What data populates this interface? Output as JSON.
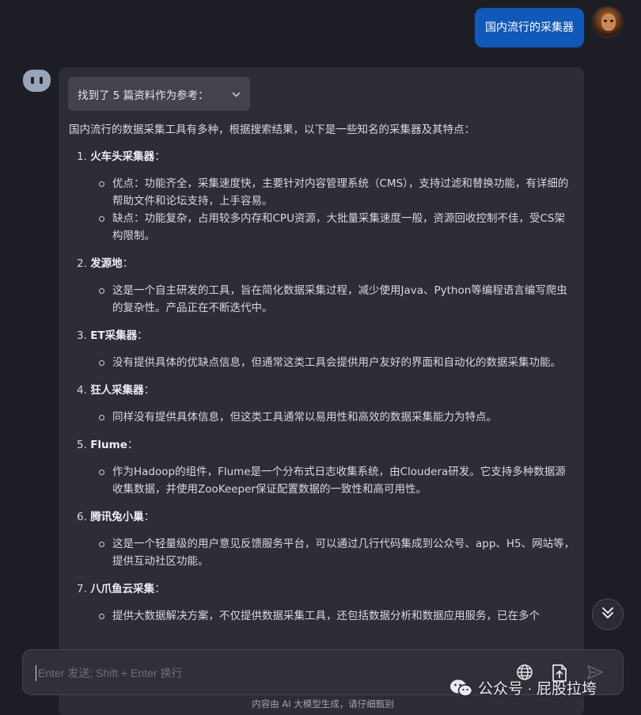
{
  "user_message": "国内流行的采集器",
  "sources_toggle": "找到了 5 篇资料作为参考：",
  "intro": "国内流行的数据采集工具有多种，根据搜索结果，以下是一些知名的采集器及其特点：",
  "items": [
    {
      "num": "1.",
      "name": "火车头采集器",
      "suffix": "：",
      "subs": [
        "优点：功能齐全，采集速度快，主要针对内容管理系统（CMS），支持过滤和替换功能，有详细的帮助文件和论坛支持，上手容易。",
        "缺点：功能复杂，占用较多内存和CPU资源，大批量采集速度一般，资源回收控制不佳，受CS架构限制。"
      ]
    },
    {
      "num": "2.",
      "name": "发源地",
      "suffix": "：",
      "subs": [
        "这是一个自主研发的工具，旨在简化数据采集过程，减少使用Java、Python等编程语言编写爬虫的复杂性。产品正在不断迭代中。"
      ]
    },
    {
      "num": "3.",
      "name": "ET采集器",
      "suffix": "：",
      "subs": [
        "没有提供具体的优缺点信息，但通常这类工具会提供用户友好的界面和自动化的数据采集功能。"
      ]
    },
    {
      "num": "4.",
      "name": "狂人采集器",
      "suffix": "：",
      "subs": [
        "同样没有提供具体信息，但这类工具通常以易用性和高效的数据采集能力为特点。"
      ]
    },
    {
      "num": "5.",
      "name": "Flume",
      "suffix": "：",
      "subs": [
        "作为Hadoop的组件，Flume是一个分布式日志收集系统，由Cloudera研发。它支持多种数据源收集数据，并使用ZooKeeper保证配置数据的一致性和高可用性。"
      ]
    },
    {
      "num": "6.",
      "name": "腾讯兔小巢",
      "suffix": "：",
      "subs": [
        "这是一个轻量级的用户意见反馈服务平台，可以通过几行代码集成到公众号、app、H5、网站等，提供互动社区功能。"
      ]
    },
    {
      "num": "7.",
      "name": "八爪鱼云采集",
      "suffix": "：",
      "subs": [
        "提供大数据解决方案，不仅提供数据采集工具，还包括数据分析和数据应用服务，已在多个"
      ]
    }
  ],
  "input": {
    "placeholder": "Enter 发送; Shift + Enter 换行",
    "value": ""
  },
  "icons": {
    "globe": "globe-icon",
    "upload": "file-upload-icon",
    "send": "send-icon",
    "scroll": "double-chevron-down-icon"
  },
  "watermark": "公众号 · 屁股拉垮",
  "footer": "内容由 AI 大模型生成，请仔细甄别",
  "colors": {
    "user_bubble": "#1059b8",
    "background": "#1d1e25",
    "panel": "#2c2d35"
  }
}
